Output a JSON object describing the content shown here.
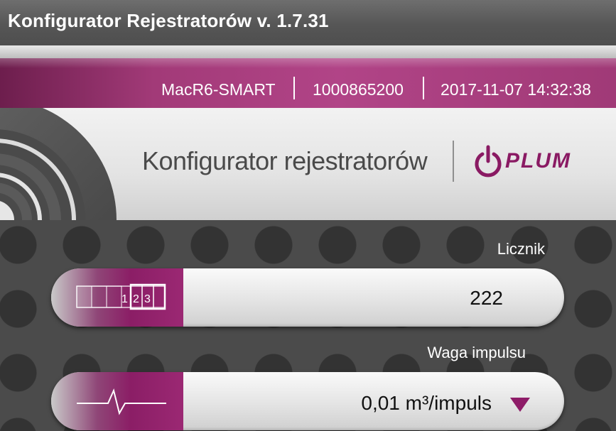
{
  "window": {
    "title": "Konfigurator Rejestratorów v. 1.7.31"
  },
  "infobar": {
    "device": "MacR6-SMART",
    "serial": "1000865200",
    "datetime": "2017-11-07 14:32:38"
  },
  "header": {
    "heading": "Konfigurator rejestratorów",
    "logo_text": "PLUM"
  },
  "fields": [
    {
      "label": "Licznik",
      "value": "222",
      "icon": "counter-icon",
      "counter_digits": [
        "",
        "",
        "",
        "1",
        "2",
        "3"
      ]
    },
    {
      "label": "Waga impulsu",
      "value": "0,01 m³/impuls",
      "icon": "pulse-wave-icon"
    }
  ],
  "colors": {
    "accent": "#8b1e66",
    "infobar": "#a23a78",
    "title_bar": "#5e5e5e"
  }
}
